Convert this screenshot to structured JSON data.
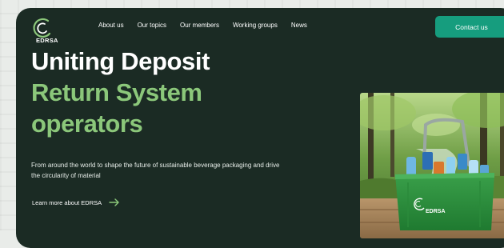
{
  "brand": {
    "name": "EDRSA"
  },
  "nav": {
    "items": [
      {
        "label": "About us"
      },
      {
        "label": "Our topics"
      },
      {
        "label": "Our members"
      },
      {
        "label": "Working groups"
      },
      {
        "label": "News"
      }
    ],
    "cta_label": "Contact us"
  },
  "hero": {
    "headline_line1": "Uniting Deposit",
    "headline_line2": "Return System",
    "headline_line3": "operators",
    "subtitle": "From around the world to shape the future of sustainable beverage packaging and drive the circularity of material",
    "learn_more_label": "Learn more about EDRSA"
  },
  "image": {
    "basket_label": "EDRSA"
  },
  "colors": {
    "hero_background": "#1b2b24",
    "accent_green": "#8bc77a",
    "button_teal": "#169d7e",
    "text_white": "#ffffff"
  },
  "icons": {
    "logo": "edrsa-logo-icon",
    "arrow": "arrow-right-icon"
  }
}
